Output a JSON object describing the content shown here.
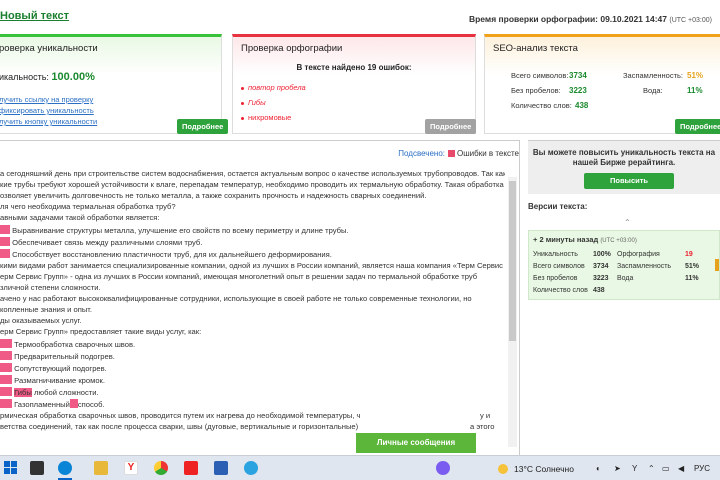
{
  "header": {
    "new_text_link": "Новый текст",
    "check_time": "Время проверки орфографии: 09.10.2021 14:47",
    "check_time_tz": "(UTC +03:00)"
  },
  "uniqueness_card": {
    "title": "роверка уникальности",
    "label": "икальность:",
    "value": "100.00%",
    "links": [
      "лучить ссылку на проверку",
      "фиксировать уникальность",
      "лучить кнопку уникальности"
    ],
    "more_button": "Подробнее"
  },
  "spelling_card": {
    "title": "Проверка орфографии",
    "found": "В тексте найдено 19 ошибок:",
    "errors": [
      "повтор пробела",
      "Гибы",
      "нихромовые"
    ],
    "more_button": "Подробнее"
  },
  "seo_card": {
    "title": "SEO-анализ текста",
    "rows_left": [
      {
        "label": "Всего символов:",
        "value": "3734"
      },
      {
        "label": "Без пробелов:",
        "value": "3223"
      },
      {
        "label": "Количество слов:",
        "value": "438"
      }
    ],
    "rows_right": [
      {
        "label": "Заспамленность:",
        "value": "51%"
      },
      {
        "label": "Вода:",
        "value": "11%"
      }
    ],
    "more_button": "Подробнее"
  },
  "text_pane": {
    "legend_label": "Подсвечено:",
    "legend_item": "Ошибки в тексте",
    "lines": [
      "а сегодняшний день при строительстве систем водоснабжения, остается актуальным вопрос о качестве используемых трубопроводов. Так как",
      "кие трубы требуют хорошей устойчивости к влаге, перепадам температур, необходимо проводить их термальную обработку. Такая обработка",
      "озволяет увеличить долговечность не только металла, а также сохранить прочность и надежность сварных соединений.",
      "ля чего необходима термальная обработка труб?",
      "авными задачами такой обработки является:",
      "Выравнивание структуры металла, улучшение его свойств по всему периметру и длине трубы.",
      "Обеспечивает связь между различными слоями труб.",
      "Способствует восстановлению пластичности труб, для их дальнейшего деформирования.",
      "кими видами работ занимается специализированные компании, одной из лучших в России компаний, является наша компания «Терм Сервис Групп».",
      "ерм Сервис Групп» - одна из лучших в России компаний, имеющая многолетний опыт в решении задач по термальной обработке труб",
      "зличной степени сложности.",
      "ачено у нас работают высококвалифицированные сотрудники, использующие в своей работе не только современные технологии, но",
      "копленные знания и опыт.",
      "ды оказываемых услуг.",
      "ерм Сервис Групп» предоставляет такие виды услуг, как:",
      "Термообработка сварочных швов.",
      "Предварительный подогрев.",
      "Сопутствующий подогрев.",
      "Размагничивание кромок.",
      "любой сложности.",
      "Газопламенный",
      "рмическая обработка сварочных швов, проводится путем их нагрева до необходимой температуры, ч",
      "ветства соединений, так как после процесса сварки, швы (дуговые, вертикальные и горизонтальные)"
    ],
    "gyby_word": "Гибы",
    "gas_suffix": "способ.",
    "tail_right_1": "у и",
    "tail_right_2": "а этого"
  },
  "right_pane": {
    "promo": "Вы можете повысить уникальность текста на нашей Бирже рерайтинга.",
    "promo_button": "Повысить уникальность",
    "versions_title": "Версии текста:",
    "version_head": "2 минуты назад",
    "version_tz": "(UTC +03:00)",
    "rows": [
      {
        "label": "Уникальность",
        "value": "100%",
        "label2": "Орфография",
        "value2": "19"
      },
      {
        "label": "Всего символов",
        "value": "3734",
        "label2": "Заспамленность",
        "value2": "51%"
      },
      {
        "label": "Без пробелов",
        "value": "3223",
        "label2": "Вода",
        "value2": "11%"
      },
      {
        "label": "Количество слов",
        "value": "438",
        "label2": "",
        "value2": ""
      }
    ]
  },
  "chat_button": "Личные сообщения",
  "taskbar": {
    "weather": "13°C Солнечно",
    "lang": "РУС"
  }
}
